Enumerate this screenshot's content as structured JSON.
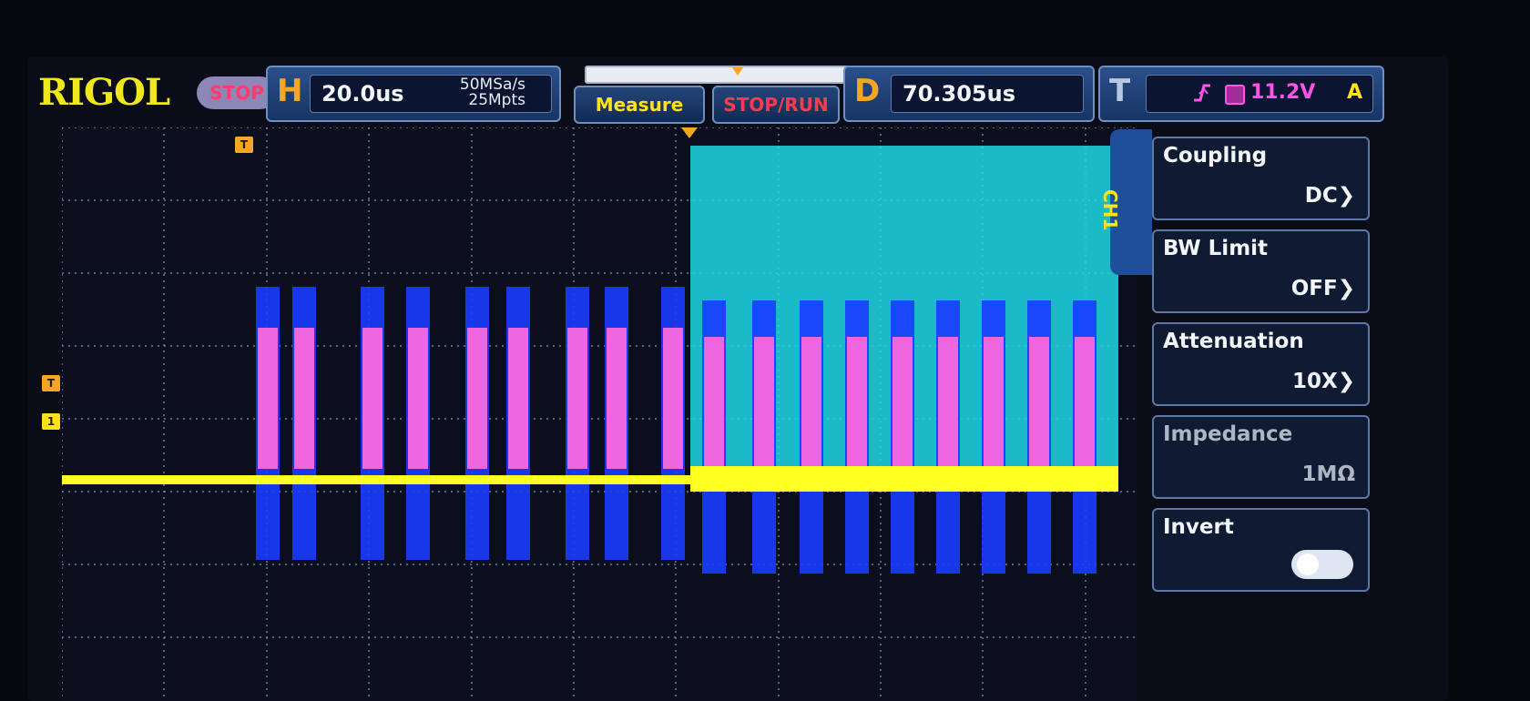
{
  "brand": "RIGOL",
  "run_state": "STOP",
  "horizontal": {
    "letter": "H",
    "timebase": "20.0us",
    "sample_rate": "50MSa/s",
    "memory_depth": "25Mpts"
  },
  "buttons": {
    "measure": "Measure",
    "stop_run": "STOP/RUN"
  },
  "delay": {
    "letter": "D",
    "value": "70.305us"
  },
  "trigger": {
    "letter": "T",
    "level": "11.2V",
    "source": "A"
  },
  "markers": {
    "trigger_top": "T",
    "trigger_left": "T",
    "ch1_ref": "1"
  },
  "channel_menu": {
    "channel": "CH1",
    "items": [
      {
        "label": "Coupling",
        "value": "DC"
      },
      {
        "label": "BW Limit",
        "value": "OFF"
      },
      {
        "label": "Attenuation",
        "value": "10X"
      },
      {
        "label": "Impedance",
        "value": "1MΩ"
      },
      {
        "label": "Invert",
        "value": ""
      }
    ]
  },
  "colors": {
    "ch1": "#ffff22",
    "ch2": "#1ed8e8",
    "ch3": "#ee66e0",
    "ch4": "#1a3cff",
    "accent": "#f5a623"
  }
}
